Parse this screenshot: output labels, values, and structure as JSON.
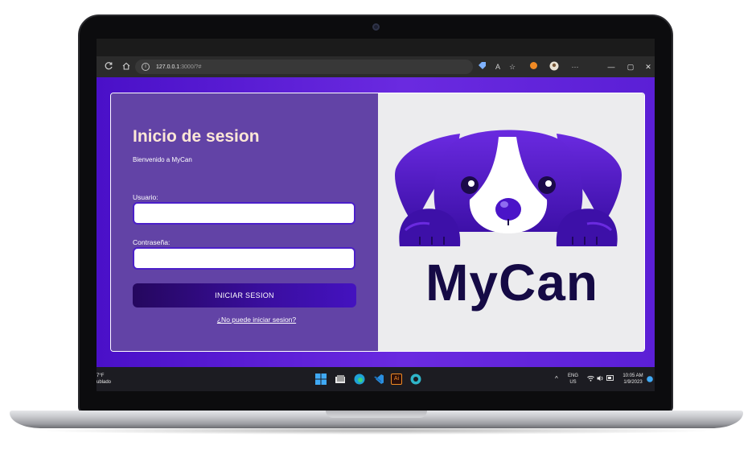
{
  "browser": {
    "address_host": "127.0.0.1",
    "address_path": ":3000/?#",
    "nav_icons": [
      "refresh-icon",
      "home-icon"
    ],
    "toolbar_icons": [
      "tag-icon",
      "read-aloud-icon",
      "favorite-icon",
      "extension-icon",
      "profile-icon",
      "more-icon"
    ],
    "more_label": "···",
    "window_controls": {
      "minimize": "—",
      "maximize": "▢",
      "close": "✕"
    }
  },
  "login": {
    "title": "Inicio de sesion",
    "welcome": "Bienvenido a MyCan",
    "username_label": "Usuario:",
    "username_value": "",
    "password_label": "Contraseña:",
    "password_value": "",
    "submit_label": "INICIAR SESION",
    "forgot_link": "¿No puede iniciar sesion?"
  },
  "brand": {
    "name": "MyCan",
    "logo_icon": "dog-logo-icon"
  },
  "colors": {
    "page_gradient_start": "#4a10c8",
    "page_gradient_end": "#6a2ae0",
    "panel": "#6243a6",
    "title_text": "#fde7d6",
    "button": "#2a0a6e",
    "brand_text": "#150a45",
    "logo_purple": "#5b21d6"
  },
  "taskbar": {
    "weather_temp": "7°F",
    "weather_desc": "ublado",
    "apps": [
      "windows-start-icon",
      "file-explorer-icon",
      "edge-icon",
      "vscode-icon",
      "illustrator-icon",
      "edge-dev-icon"
    ],
    "illustrator_label": "Ai",
    "tray_chevron": "^",
    "language": "ENG",
    "region": "US",
    "time": "10:05 AM",
    "date": "1/9/2023"
  }
}
